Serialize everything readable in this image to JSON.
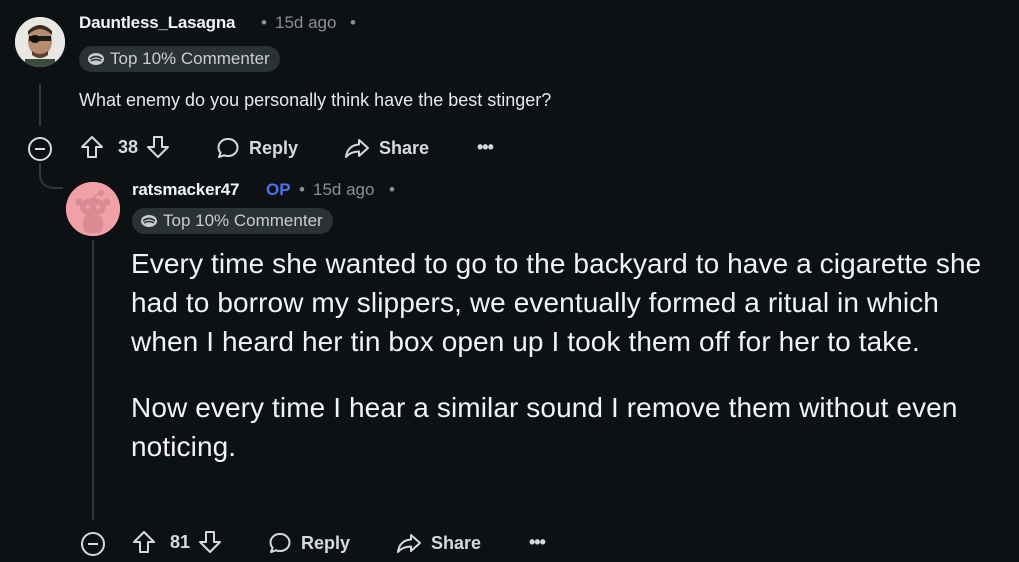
{
  "comments": [
    {
      "username": "Dauntless_Lasagna",
      "separator": "•",
      "time": "15d ago",
      "trailing": "•",
      "badge": "Top 10% Commenter",
      "body": "What enemy do you personally think have the best stinger?",
      "votes": "38",
      "reply_label": "Reply",
      "share_label": "Share",
      "more_label": "•••"
    },
    {
      "username": "ratsmacker47",
      "op_tag": "OP",
      "separator": "•",
      "time": "15d ago",
      "trailing": "•",
      "badge": "Top 10% Commenter",
      "body_paragraphs": [
        "Every time she wanted to go to the backyard to have a cigarette she had to borrow my slippers, we eventually formed a ritual in which when I heard her tin box open up I took them off for her to take.",
        "Now every time I hear a similar sound I remove them without even noticing."
      ],
      "votes": "81",
      "reply_label": "Reply",
      "share_label": "Share",
      "more_label": "•••"
    }
  ]
}
